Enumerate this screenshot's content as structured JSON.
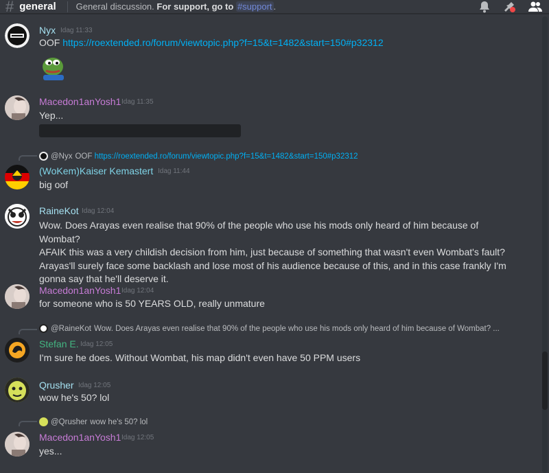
{
  "channel": {
    "name": "general",
    "topic_prefix": "General discussion.",
    "topic_bold": "For support, go to",
    "topic_channel": "#support",
    "topic_suffix": "."
  },
  "icons": [
    "bell-icon",
    "pin-icon",
    "members-icon"
  ],
  "colors": {
    "background": "#36393f",
    "link": "#00b0f4",
    "nyx": "#a5e0f0",
    "macedon": "#c77cd6",
    "kaiser": "#7fd3e6",
    "rainekot": "#a5e0f0",
    "stefan": "#43b581",
    "qrusher": "#a5e0f0"
  },
  "messages": [
    {
      "author": "Nyx",
      "time": "Idag 11:33",
      "text_prefix": "OOF ",
      "link": "https://roextended.ro/forum/viewtopic.php?f=15&t=1482&start=150#p32312"
    },
    {
      "author": "Macedon1anYosh1",
      "time": "Idag 11:35",
      "text": "Yep..."
    },
    {
      "reply_to": "@Nyx",
      "reply_text": "OOF",
      "reply_link": "https://roextended.ro/forum/viewtopic.php?f=15&t=1482&start=150#p32312",
      "author": "(WoKem)Kaiser Kemastert",
      "time": "Idag 11:44",
      "text": "big oof"
    },
    {
      "author": "RaineKot",
      "time": "Idag 12:04",
      "lines": [
        "Wow. Does Arayas even realise that 90% of the people who use his mods only heard of him because of Wombat?",
        "AFAIK this was a very childish decision from him, just because of something that wasn't even Wombat's fault?",
        "Arayas'll surely face some backlash and lose most of his audience because of this, and in this case frankly I'm",
        "gonna say that he'll deserve it."
      ]
    },
    {
      "author": "Macedon1anYosh1",
      "time": "Idag 12:04",
      "text": "for someone who is 50 YEARS OLD, really unmature"
    },
    {
      "reply_to": "@RaineKot",
      "reply_text": "Wow. Does Arayas even realise that 90% of the people who use his mods only heard of him because of Wombat? ...",
      "author": "Stefan E.",
      "time": "Idag 12:05",
      "text": "I'm sure he does. Without Wombat, his map didn't even have 50 PPM users"
    },
    {
      "author": "Qrusher",
      "time": "Idag 12:05",
      "text": "wow he's 50? lol"
    },
    {
      "reply_to": "@Qrusher",
      "reply_text": "wow he's 50? lol",
      "author": "Macedon1anYosh1",
      "time": "Idag 12:05",
      "text": "yes..."
    }
  ]
}
